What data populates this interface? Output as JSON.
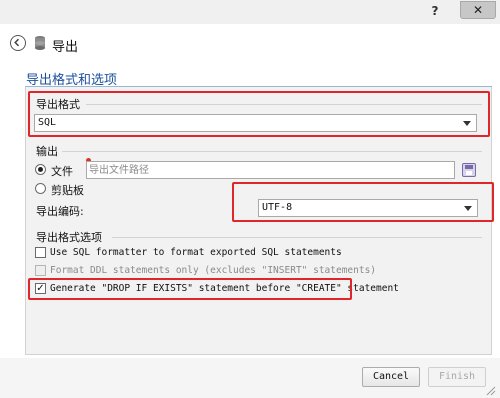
{
  "window": {
    "help_label": "?",
    "close_label": "✕"
  },
  "header": {
    "title": "导出"
  },
  "section": {
    "title": "导出格式和选项"
  },
  "format_group": {
    "label": "导出格式",
    "selected": "SQL"
  },
  "output_group": {
    "label": "输出",
    "file_label": "文件",
    "file_placeholder": "导出文件路径",
    "clipboard_label": "剪贴板",
    "encoding_label": "导出编码:",
    "encoding_value": "UTF-8",
    "selected_target": "文件"
  },
  "options_group": {
    "label": "导出格式选项",
    "options": [
      {
        "label": "Use SQL formatter to format exported SQL statements",
        "checked": false,
        "enabled": true
      },
      {
        "label": "Format DDL statements only (excludes \"INSERT\" statements)",
        "checked": false,
        "enabled": false
      },
      {
        "label": "Generate \"DROP IF EXISTS\" statement before \"CREATE\" statement",
        "checked": true,
        "enabled": true
      }
    ]
  },
  "footer": {
    "cancel_label": "Cancel",
    "finish_label": "Finish"
  },
  "colors": {
    "accent_title": "#1c4f9c",
    "highlight": "#e0262a"
  }
}
